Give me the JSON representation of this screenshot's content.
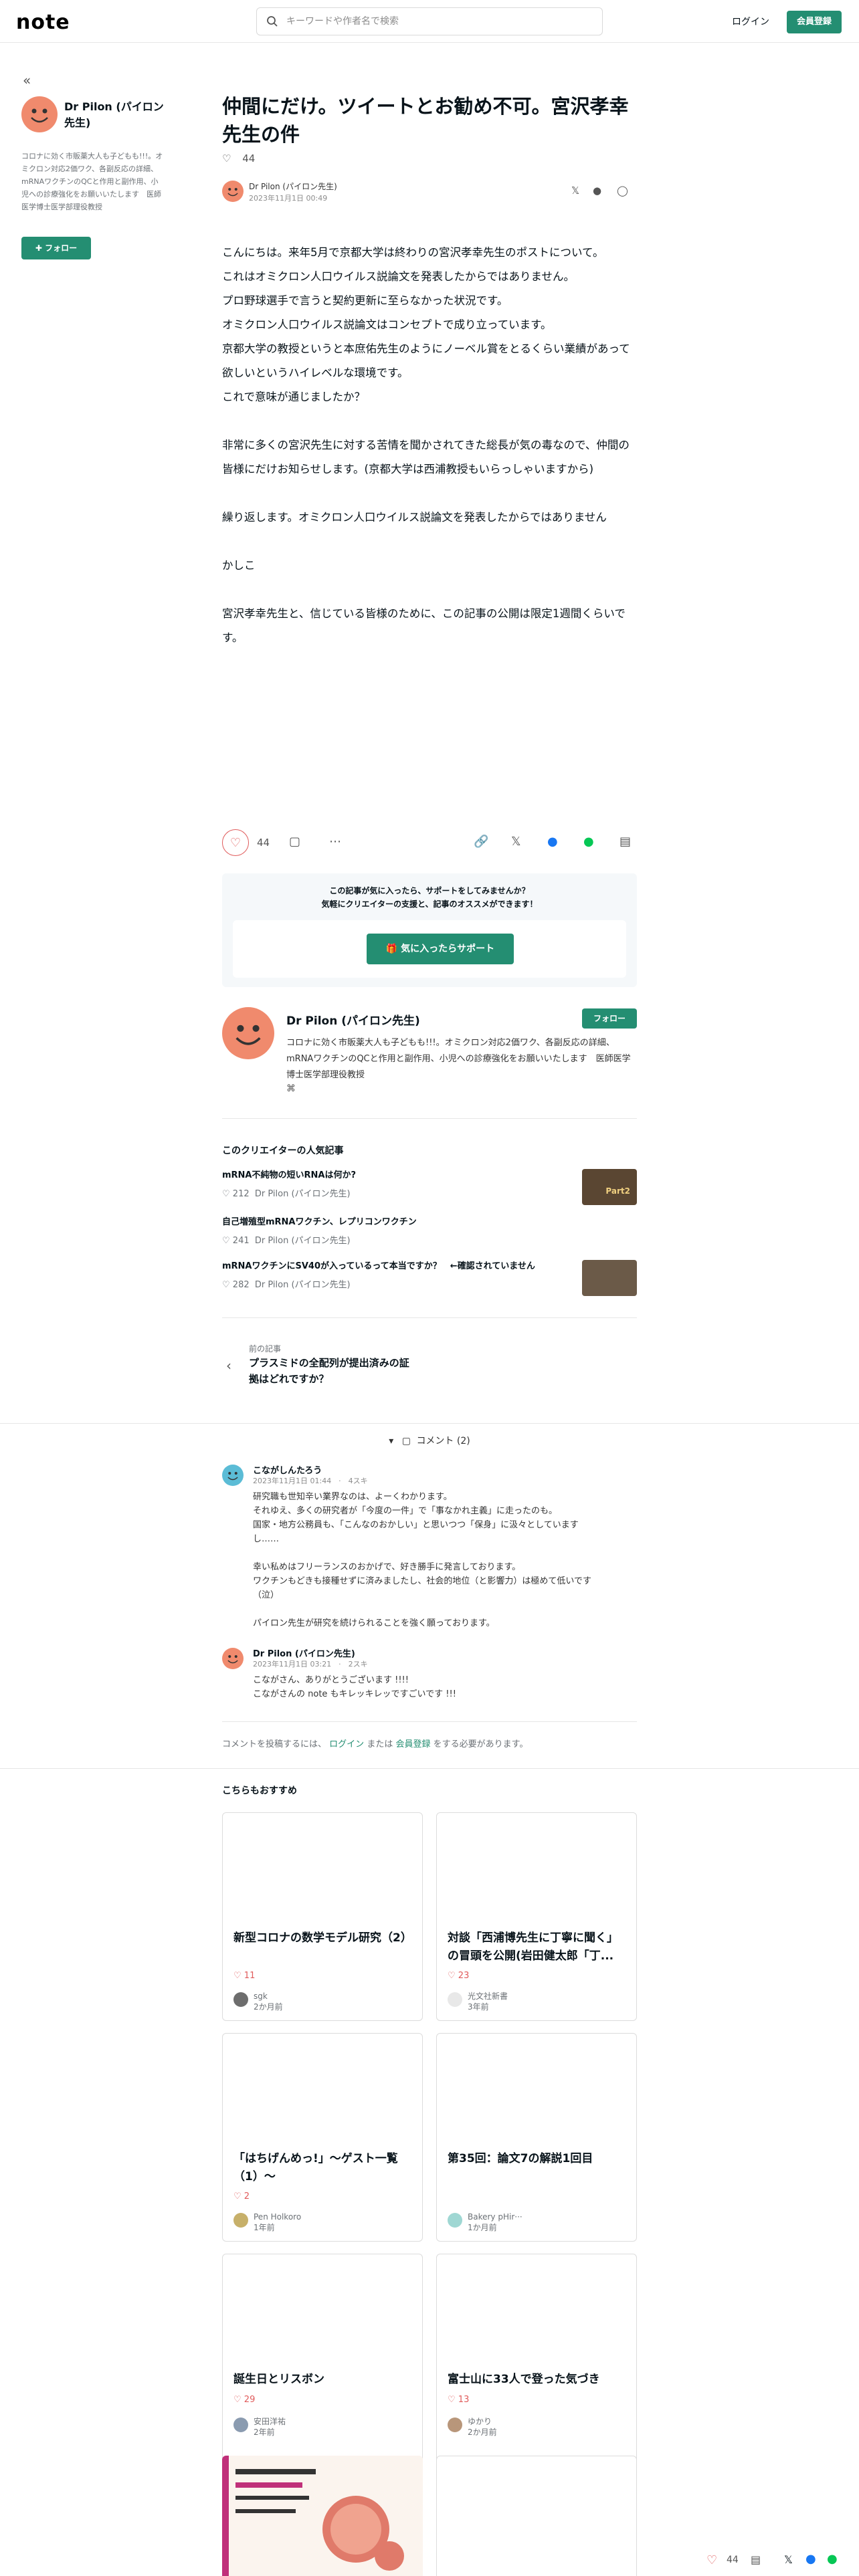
{
  "header": {
    "logo": "note",
    "search_placeholder": "キーワードや作者名で検索",
    "login": "ログイン",
    "signup": "会員登録"
  },
  "sidebar": {
    "collapse": "«",
    "name": "Dr Pilon (パイロン先生)",
    "bio": "コロナに効く市販薬大人も子どもも!!!。オミクロン対応2価ワク、各副反応の詳細、mRNAワクチンのQCと作用と副作用、小児への診療強化をお願いいたします　医師医学博士医学部理役教授",
    "follow": "フォロー"
  },
  "article": {
    "title": "仲間にだけ。ツイートとお勧め不可。宮沢孝幸先生の件",
    "likes": "44",
    "author": "Dr Pilon (パイロン先生)",
    "date": "2023年11月1日 00:49",
    "body": [
      "こんにちは。来年5月で京都大学は終わりの宮沢孝幸先生のポストについて。",
      "これはオミクロン人口ウイルス説論文を発表したからではありません。",
      "プロ野球選手で言うと契約更新に至らなかった状況です。",
      "オミクロン人口ウイルス説論文はコンセプトで成り立っています。",
      "京都大学の教授というと本庶佑先生のようにノーベル賞をとるくらい業績があって欲しいというハイレベルな環境です。",
      "これで意味が通じましたか？",
      "",
      "非常に多くの宮沢先生に対する苦情を聞かされてきた総長が気の毒なので、仲間の皆様にだけお知らせします。(京都大学は西浦教授もいらっしゃいますから)",
      "",
      "繰り返します。オミクロン人口ウイルス説論文を発表したからではありません",
      "",
      "かしこ",
      "",
      "宮沢孝幸先生と、信じている皆様のために、この記事の公開は限定1週間くらいです。"
    ]
  },
  "actions": {
    "likes": "44",
    "support_text_1": "この記事が気に入ったら、サポートをしてみませんか？",
    "support_text_2": "気軽にクリエイターの支援と、記事のオススメができます！",
    "support_button": "気に入ったらサポート"
  },
  "creator": {
    "name": "Dr Pilon (パイロン先生)",
    "follow": "フォロー",
    "bio": "コロナに効く市販薬大人も子どもも!!!。オミクロン対応2価ワク、各副反応の詳細、mRNAワクチンのQCと作用と副作用、小児への診療強化をお願いいたします　医師医学博士医学部理役教授"
  },
  "popular": {
    "heading": "このクリエイターの人気記事",
    "items": [
      {
        "title": "mRNA不純物の短いRNAは何か?",
        "likes": "212",
        "author": "Dr Pilon (パイロン先生)",
        "thumb": "Part2"
      },
      {
        "title": "自己増殖型mRNAワクチン、レプリコンワクチン",
        "likes": "241",
        "author": "Dr Pilon (パイロン先生)",
        "thumb": ""
      },
      {
        "title": "mRNAワクチンにSV40が入っているって本当ですか？　←確認されていません",
        "likes": "282",
        "author": "Dr Pilon (パイロン先生)",
        "thumb": ""
      }
    ]
  },
  "prev": {
    "label": "前の記事",
    "title": "プラスミドの全配列が提出済みの証拠はどれですか？"
  },
  "comments": {
    "toggle": "コメント (2)",
    "items": [
      {
        "name": "こながしんたろう",
        "meta": "2023年11月1日 01:44　·　4スキ",
        "body": [
          "研究職も世知辛い業界なのは、よーくわかります。",
          "それゆえ、多くの研究者が「今度の一件」で「事なかれ主義」に走ったのも。",
          "国家・地方公務員も、「こんなのおかしい」と思いつつ「保身」に汲々としています",
          "し……",
          "",
          "幸い私めはフリーランスのおかげで、好き勝手に発言しております。",
          "ワクチンもどきも接種せずに済みましたし、社会的地位（と影響力）は極めて低いです",
          "（泣）",
          "",
          "パイロン先生が研究を続けられることを強く願っております。"
        ]
      },
      {
        "name": "Dr Pilon (パイロン先生)",
        "meta": "2023年11月1日 03:21　·　2スキ",
        "body": [
          "こながさん、ありがとうございます !!!!",
          "こながさんの note もキレッキレッですごいです !!!"
        ]
      }
    ],
    "login_note_pre": "コメントを投稿するには、",
    "login_link": "ログイン",
    "login_mid": "または",
    "signup_link": "会員登録",
    "login_note_post": "をする必要があります。"
  },
  "recommend": {
    "heading": "こちらもおすすめ",
    "cards": [
      {
        "title": "新型コロナの数学モデル研究（2）",
        "likes": "11",
        "author": "sgk",
        "time": "2か月前"
      },
      {
        "title": "対談「西浦博先生に丁寧に聞く」の冒頭を公開(岩田健太郎「丁...",
        "likes": "23",
        "author": "光文社新書",
        "time": "3年前"
      },
      {
        "title": "「はちげんめっ!」～ゲスト一覧（1）～",
        "likes": "2",
        "author": "Pen Holkoro",
        "time": "1年前"
      },
      {
        "title": "第35回：論文7の解説1回目",
        "likes": "",
        "author": "Bakery pHir···",
        "time": "1か月前"
      },
      {
        "title": "誕生日とリスボン",
        "likes": "29",
        "author": "安田洋祐",
        "time": "2年前"
      },
      {
        "title": "富士山に33人で登った気づき",
        "likes": "13",
        "author": "ゆかり",
        "time": "2か月前"
      }
    ]
  },
  "bottom_bar": {
    "likes": "44"
  },
  "colors": {
    "brand": "#248e72",
    "like": "#e05b5b",
    "avatar": "#f08a6d"
  }
}
